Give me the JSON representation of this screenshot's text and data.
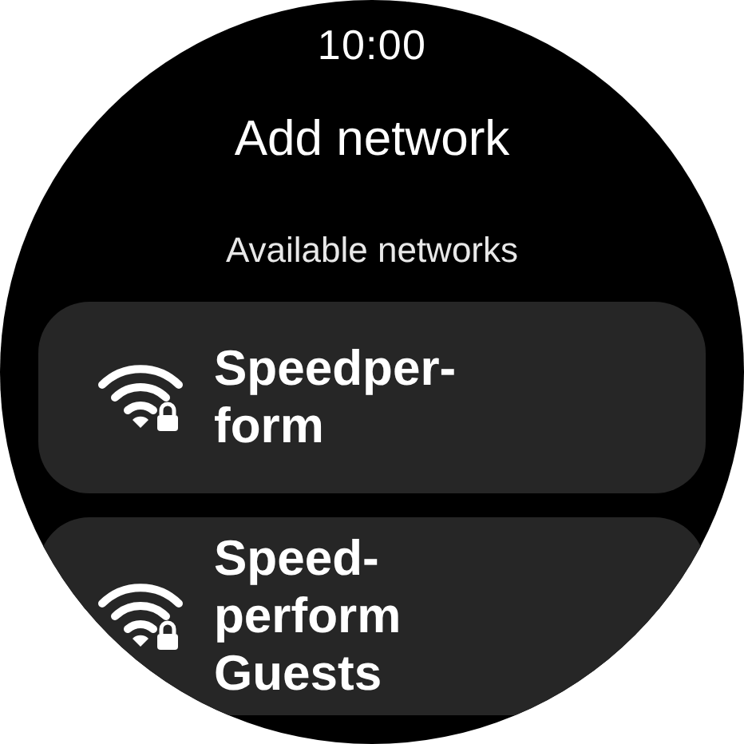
{
  "status_bar": {
    "time": "10:00"
  },
  "title": "Add network",
  "section_label": "Available networks",
  "networks": [
    {
      "name": "Speedper-\nform",
      "secured": true
    },
    {
      "name": "Speed-\nperform\nGuests",
      "secured": true
    }
  ]
}
